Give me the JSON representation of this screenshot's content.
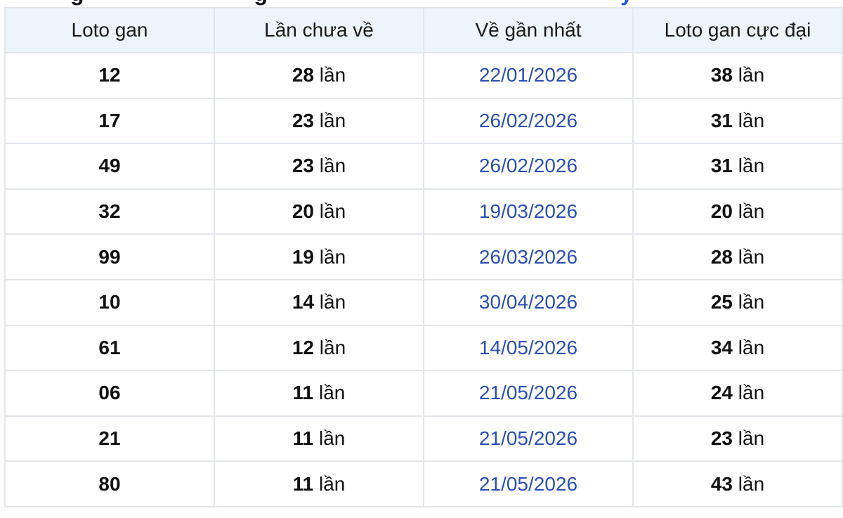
{
  "heading": {
    "fragment_left": "g",
    "fragment_mid": "g",
    "fragment_accent": "y"
  },
  "table": {
    "columns": [
      "Loto gan",
      "Lần chưa về",
      "Về gần nhất",
      "Loto gan cực đại"
    ],
    "unit": "lần",
    "rows": [
      {
        "loto": "12",
        "missed": "28",
        "last": "22/01/2026",
        "max": "38"
      },
      {
        "loto": "17",
        "missed": "23",
        "last": "26/02/2026",
        "max": "31"
      },
      {
        "loto": "49",
        "missed": "23",
        "last": "26/02/2026",
        "max": "31"
      },
      {
        "loto": "32",
        "missed": "20",
        "last": "19/03/2026",
        "max": "20"
      },
      {
        "loto": "99",
        "missed": "19",
        "last": "26/03/2026",
        "max": "28"
      },
      {
        "loto": "10",
        "missed": "14",
        "last": "30/04/2026",
        "max": "25"
      },
      {
        "loto": "61",
        "missed": "12",
        "last": "14/05/2026",
        "max": "34"
      },
      {
        "loto": "06",
        "missed": "11",
        "last": "21/05/2026",
        "max": "24"
      },
      {
        "loto": "21",
        "missed": "11",
        "last": "21/05/2026",
        "max": "23"
      },
      {
        "loto": "80",
        "missed": "11",
        "last": "21/05/2026",
        "max": "43"
      }
    ]
  },
  "colors": {
    "header_bg": "#eef4fb",
    "date_text": "#2a4fb8",
    "border": "#e3e6eb"
  }
}
